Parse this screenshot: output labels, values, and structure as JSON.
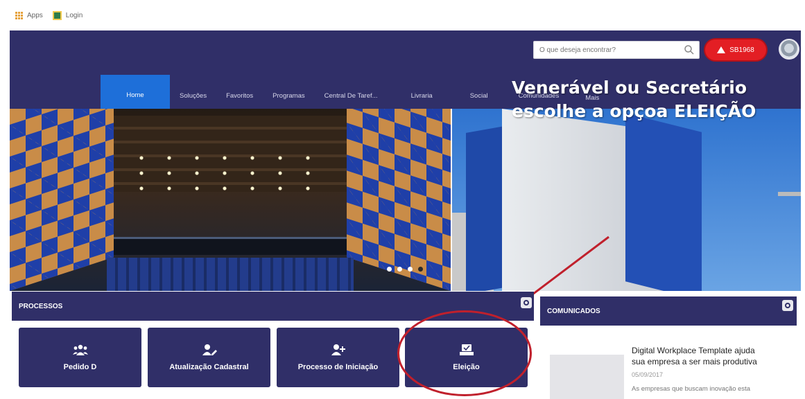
{
  "bookmarks": [
    {
      "label": "Apps",
      "icon": "apps-grid-icon"
    },
    {
      "label": "Login",
      "icon": "login-icon"
    }
  ],
  "header": {
    "search_placeholder": "O que deseja encontrar?",
    "alert_label": "SB1968",
    "colors": {
      "header_bg": "#302f68",
      "active_tab": "#1e6fd9",
      "alert": "#e31e24"
    }
  },
  "nav": {
    "items": [
      "Home",
      "Soluções",
      "Favoritos",
      "Programas",
      "Central De Taref...",
      "Livraria",
      "Social",
      "Comunidades",
      "Mais"
    ],
    "active_index": 0
  },
  "hero": {
    "caption_line1": "Venerável ou Secretário",
    "caption_line2": "escolhe a opçoa ELEIÇÃO",
    "slide_count": 3
  },
  "processos": {
    "title": "PROCESSOS",
    "tiles": [
      {
        "label": "Pedido D",
        "icon": "users-group-icon"
      },
      {
        "label": "Atualização Cadastral",
        "icon": "user-edit-icon"
      },
      {
        "label": "Processo de Iniciação",
        "icon": "user-add-icon"
      },
      {
        "label": "Eleição",
        "icon": "ballot-box-icon"
      }
    ]
  },
  "comunicados": {
    "title": "COMUNICADOS",
    "items": [
      {
        "title": "Digital Workplace Template ajuda sua empresa a ser mais produtiva",
        "date": "05/09/2017",
        "excerpt": "As empresas que buscam inovação esta"
      }
    ]
  },
  "annotation": {
    "color": "#c0202c"
  }
}
